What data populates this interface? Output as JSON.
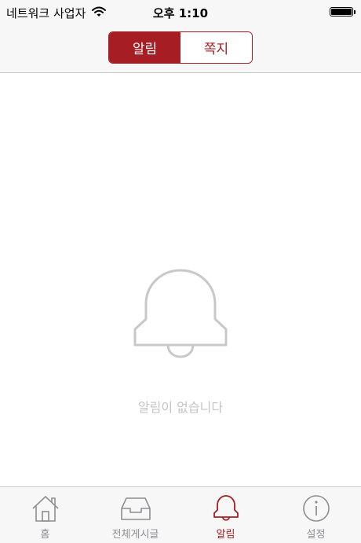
{
  "status_bar": {
    "carrier": "네트워크 사업자",
    "time": "오후 1:10",
    "wifi_icon": "wifi-icon",
    "battery_icon": "battery-icon"
  },
  "segmented_control": {
    "segments": [
      {
        "label": "알림",
        "selected": true
      },
      {
        "label": "쪽지",
        "selected": false
      }
    ]
  },
  "empty_state": {
    "icon": "bell-outline-icon",
    "message": "알림이 없습니다"
  },
  "tab_bar": {
    "tabs": [
      {
        "label": "홈",
        "icon": "home-icon",
        "active": false
      },
      {
        "label": "전체게시글",
        "icon": "inbox-tray-icon",
        "active": false
      },
      {
        "label": "알림",
        "icon": "bell-icon",
        "active": true
      },
      {
        "label": "설정",
        "icon": "info-circle-icon",
        "active": false
      }
    ]
  },
  "colors": {
    "accent": "#a61d24",
    "inactive": "#8e8e93",
    "empty_icon": "#c8c8c8",
    "bar_background": "#f7f7f7"
  }
}
